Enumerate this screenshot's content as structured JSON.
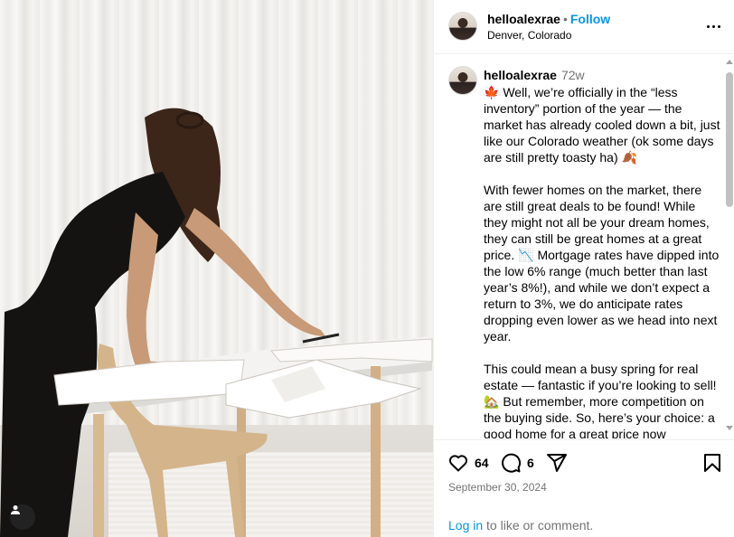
{
  "post": {
    "username": "helloalexrae",
    "follow_label": "Follow",
    "separator": "•",
    "location": "Denver, Colorado"
  },
  "caption": {
    "username": "helloalexrae",
    "time_ago": "72w",
    "paragraphs": [
      "🍁 Well, we’re officially in the “less inventory” portion of the year — the market has already cooled down a bit, just like our Colorado weather (ok some days are still pretty toasty ha) 🍂",
      "With fewer homes on the market, there are still great deals to be found! While they might not all be your dream homes, they can still be great homes at a great price. 📉 Mortgage rates have dipped into the low 6% range (much better than last year’s 8%!), and while we don’t expect a return to 3%, we do anticipate rates dropping even lower as we head into next year.",
      "This could mean a busy spring for real estate — fantastic if you’re looking to sell! 🏡 But remember, more competition on the buying side. So, here’s your choice: a good home for a great price now"
    ]
  },
  "actions": {
    "likes": "64",
    "comments": "6"
  },
  "date": "September 30, 2024",
  "footer": {
    "login_label": "Log in",
    "login_suffix": " to like or comment."
  },
  "icons": {
    "like": "heart-icon",
    "comment": "comment-bubble-icon",
    "share": "paper-plane-icon",
    "save": "bookmark-icon",
    "more": "more-options-icon",
    "tagged": "user-tag-icon"
  },
  "colors": {
    "link": "#0095f6",
    "muted": "#737373",
    "divider": "#efefef"
  }
}
